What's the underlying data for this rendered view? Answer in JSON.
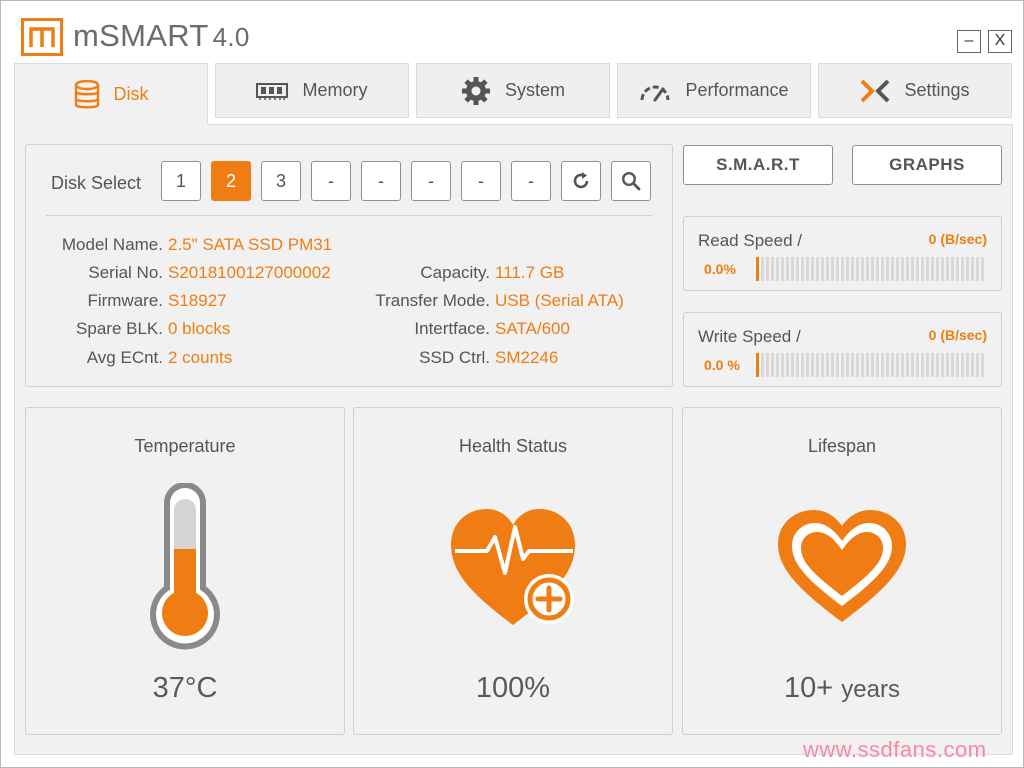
{
  "app": {
    "title": "mSMART",
    "version": "4.0",
    "logo_letter": "m"
  },
  "window": {
    "minimize_label": "–",
    "close_label": "X"
  },
  "tabs": [
    {
      "label": "Disk",
      "icon": "database-icon",
      "active": true
    },
    {
      "label": "Memory",
      "icon": "memory-chip-icon",
      "active": false
    },
    {
      "label": "System",
      "icon": "gear-icon",
      "active": false
    },
    {
      "label": "Performance",
      "icon": "speedometer-icon",
      "active": false
    },
    {
      "label": "Settings",
      "icon": "settings-x-icon",
      "active": false
    }
  ],
  "disk_select": {
    "label": "Disk Select",
    "buttons": [
      "1",
      "2",
      "3",
      "-",
      "-",
      "-",
      "-",
      "-"
    ],
    "selected": "2",
    "refresh_icon": "refresh-icon",
    "search_icon": "search-icon"
  },
  "disk_info": {
    "model_name": {
      "label": "Model Name.",
      "value": "2.5\" SATA SSD PM31"
    },
    "serial_no": {
      "label": "Serial No.",
      "value": "S2018100127000002"
    },
    "firmware": {
      "label": "Firmware.",
      "value": "S18927"
    },
    "spare_blk": {
      "label": "Spare BLK.",
      "value": "0 blocks"
    },
    "avg_ecnt": {
      "label": "Avg ECnt.",
      "value": "2 counts"
    },
    "capacity": {
      "label": "Capacity.",
      "value": "111.7 GB"
    },
    "transfer_mode": {
      "label": "Transfer Mode.",
      "value": "USB (Serial ATA)"
    },
    "interface": {
      "label": "Intertface.",
      "value": "SATA/600"
    },
    "ssd_ctrl": {
      "label": "SSD Ctrl.",
      "value": "SM2246"
    }
  },
  "buttons": {
    "smart": "S.M.A.R.T",
    "graphs": "GRAPHS"
  },
  "read_speed": {
    "title": "Read Speed /",
    "value": "0 (B/sec)",
    "percent": "0.0%",
    "level": 0.0
  },
  "write_speed": {
    "title": "Write Speed /",
    "value": "0 (B/sec)",
    "percent": "0.0 %",
    "level": 0.0
  },
  "temperature": {
    "title": "Temperature",
    "value": "37°C",
    "icon": "thermometer-icon"
  },
  "health": {
    "title": "Health Status",
    "value": "100%",
    "icon": "heart-pulse-plus-icon"
  },
  "lifespan": {
    "title": "Lifespan",
    "value": "10+",
    "unit": "years",
    "icon": "heart-icon"
  },
  "watermark": "www.ssdfans.com",
  "colors": {
    "accent": "#f07d13",
    "panel": "#f1f1f1",
    "border": "#cfcfcf",
    "text": "#555555"
  }
}
